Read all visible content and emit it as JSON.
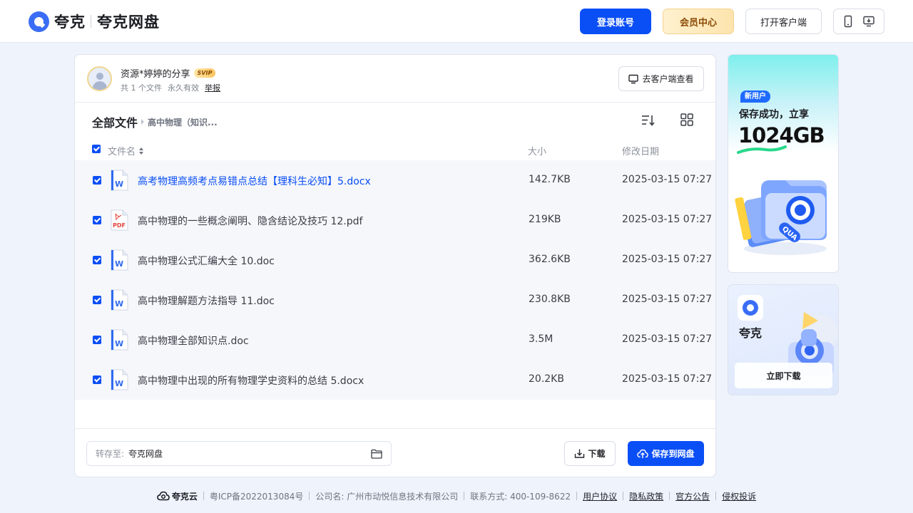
{
  "header": {
    "brand_name": "夸克",
    "brand_sub": "夸克网盘",
    "login_label": "登录账号",
    "vip_label": "会员中心",
    "client_label": "打开客户端"
  },
  "share": {
    "title": "资源*婷婷的分享",
    "badge": "SVIP",
    "file_count": "共 1 个文件",
    "validity": "永久有效",
    "report": "举报",
    "view_client_label": "去客户端查看"
  },
  "breadcrumb": {
    "root": "全部文件",
    "current": "高中物理（知识..."
  },
  "columns": {
    "name": "文件名",
    "size": "大小",
    "date": "修改日期"
  },
  "files": [
    {
      "name": "高考物理高频考点易错点总结【理科生必知】5.docx",
      "size": "142.7KB",
      "date": "2025-03-15 07:27",
      "type": "word",
      "checked": true
    },
    {
      "name": "高中物理的一些概念阐明、隐含结论及技巧 12.pdf",
      "size": "219KB",
      "date": "2025-03-15 07:27",
      "type": "pdf",
      "checked": true
    },
    {
      "name": "高中物理公式汇编大全 10.doc",
      "size": "362.6KB",
      "date": "2025-03-15 07:27",
      "type": "word",
      "checked": true
    },
    {
      "name": "高中物理解题方法指导 11.doc",
      "size": "230.8KB",
      "date": "2025-03-15 07:27",
      "type": "word",
      "checked": true
    },
    {
      "name": "高中物理全部知识点.doc",
      "size": "3.5M",
      "date": "2025-03-15 07:27",
      "type": "word",
      "checked": true
    },
    {
      "name": "高中物理中出现的所有物理学史资料的总结 5.docx",
      "size": "20.2KB",
      "date": "2025-03-15 07:27",
      "type": "word",
      "checked": true
    }
  ],
  "save_bar": {
    "label": "转存至:",
    "destination": "夸克网盘",
    "download_label": "下载",
    "save_label": "保存到网盘"
  },
  "promo_new_user": {
    "tag": "新用户",
    "line1": "保存成功，立享",
    "amount": "1024GB"
  },
  "promo_app": {
    "app_name": "夸克",
    "download_label": "立即下载"
  },
  "footer": {
    "brand": "夸克云",
    "icp": "粤ICP备2022013084号",
    "company": "公司名: 广州市动悦信息技术有限公司",
    "contact": "联系方式: 400-109-8622",
    "links": [
      "用户协议",
      "隐私政策",
      "官方公告",
      "侵权投诉"
    ]
  },
  "colors": {
    "accent": "#0a4ef6",
    "vip_text": "#8b4a06",
    "page_bg": "#eef3fc"
  }
}
